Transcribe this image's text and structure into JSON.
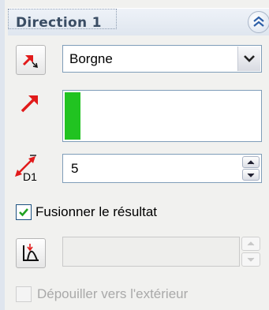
{
  "section": {
    "title": "Direction 1",
    "collapse_icon": "double-chevron-up-icon"
  },
  "end_condition": {
    "icon": "reverse-direction-icon",
    "selected": "Borgne",
    "dropdown_icon": "chevron-down-icon"
  },
  "direction_vector": {
    "icon": "direction-arrow-icon",
    "accent_color": "#21c321"
  },
  "depth": {
    "icon": "depth-d1-icon",
    "icon_label": "D1",
    "value": "5"
  },
  "merge_result": {
    "label": "Fusionner le résultat",
    "checked": true
  },
  "draft": {
    "icon": "draft-angle-icon",
    "value": ""
  },
  "draft_outward": {
    "label": "Dépouiller vers l'extérieur",
    "checked": false,
    "enabled": false
  }
}
